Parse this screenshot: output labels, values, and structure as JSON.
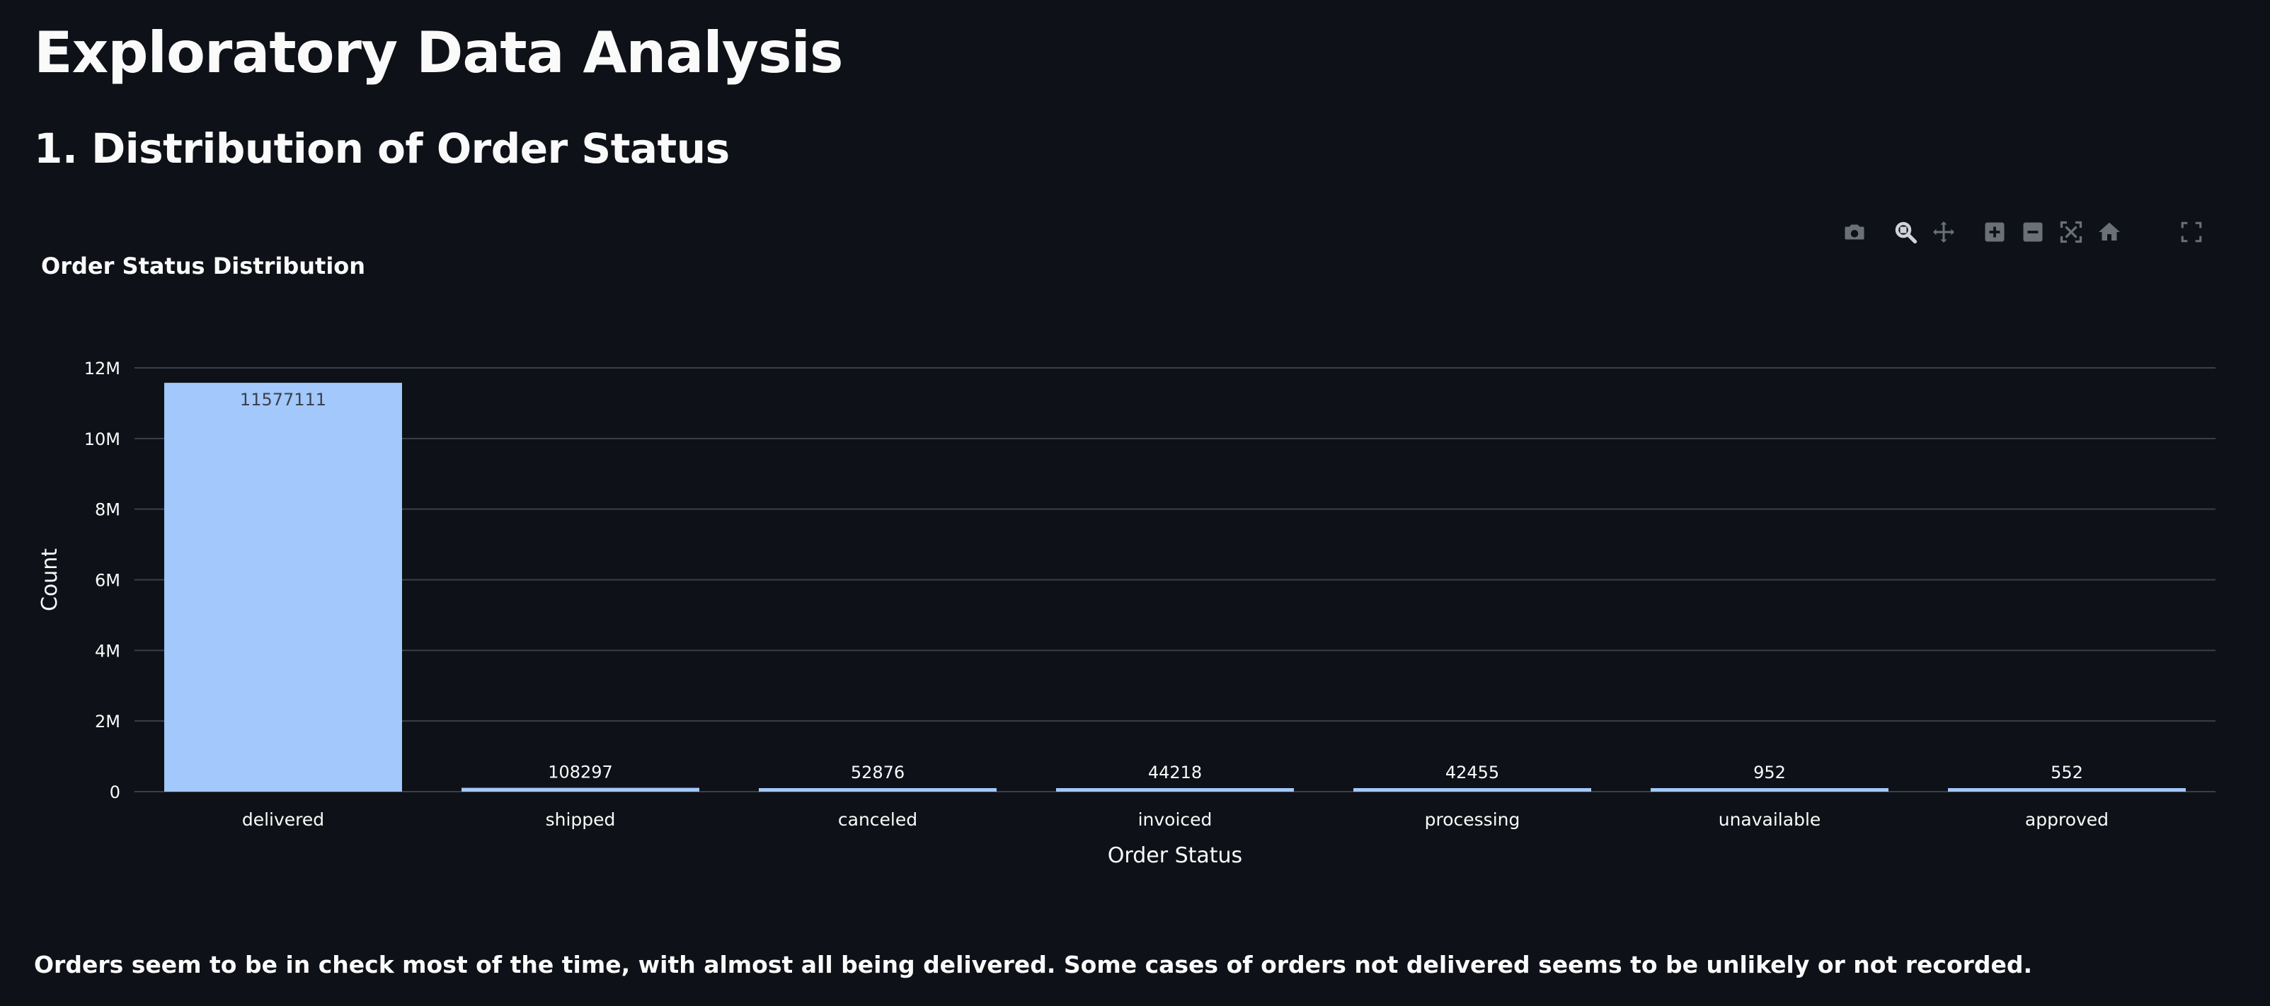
{
  "page": {
    "title": "Exploratory Data Analysis",
    "section_title": "1. Distribution of Order Status",
    "footer_note": "Orders seem to be in check most of the time, with almost all being delivered. Some cases of orders not delivered seems to be unlikely or not recorded."
  },
  "toolbar": {
    "icons": [
      "camera-icon",
      "zoom-icon",
      "pan-icon",
      "zoom-in-icon",
      "zoom-out-icon",
      "autoscale-icon",
      "reset-axes-icon"
    ],
    "fullscreen_icon": "fullscreen-icon"
  },
  "colors": {
    "background": "#0e1117",
    "bar": "#a3c8fb",
    "gridline": "#3a3f4b",
    "text": "#fafafa",
    "icon": "#6b6f78"
  },
  "chart_data": {
    "type": "bar",
    "title": "Order Status Distribution",
    "xlabel": "Order Status",
    "ylabel": "Count",
    "categories": [
      "delivered",
      "shipped",
      "canceled",
      "invoiced",
      "processing",
      "unavailable",
      "approved"
    ],
    "values": [
      11577111,
      108297,
      52876,
      44218,
      42455,
      952,
      552
    ],
    "data_labels": [
      "11577111",
      "108297",
      "52876",
      "44218",
      "42455",
      "952",
      "552"
    ],
    "ylim": [
      0,
      12000000
    ],
    "yticks": [
      0,
      2000000,
      4000000,
      6000000,
      8000000,
      10000000,
      12000000
    ],
    "ytick_labels": [
      "0",
      "2M",
      "4M",
      "6M",
      "8M",
      "10M",
      "12M"
    ],
    "grid": true,
    "legend": "none"
  }
}
